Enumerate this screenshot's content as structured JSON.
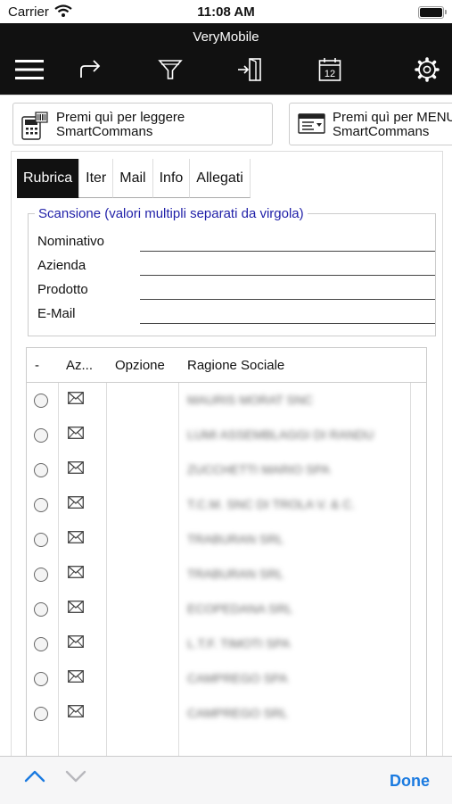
{
  "status_bar": {
    "carrier": "Carrier",
    "time": "11:08 AM"
  },
  "app": {
    "title": "VeryMobile"
  },
  "toolbar": {
    "icons": [
      "menu-icon",
      "share-arrow-icon",
      "filter-icon",
      "exit-door-icon",
      "calendar-icon",
      "gear-icon"
    ],
    "calendar_day": "12"
  },
  "scan_buttons": {
    "read": {
      "line1": "Premi quì per leggere",
      "line2": "SmartCommans"
    },
    "menu": {
      "line1": "Premi quì per MENU",
      "line2": "SmartCommans"
    }
  },
  "tabs": [
    {
      "label": "Rubrica",
      "active": true
    },
    {
      "label": "Iter",
      "active": false
    },
    {
      "label": "Mail",
      "active": false
    },
    {
      "label": "Info",
      "active": false
    },
    {
      "label": "Allegati",
      "active": false
    }
  ],
  "form": {
    "legend": "Scansione (valori multipli separati da virgola)",
    "fields": [
      {
        "label": "Nominativo",
        "value": ""
      },
      {
        "label": "Azienda",
        "value": ""
      },
      {
        "label": "Prodotto",
        "value": ""
      },
      {
        "label": "E-Mail",
        "value": ""
      }
    ]
  },
  "grid": {
    "columns": [
      "-",
      "Az...",
      "Opzione",
      "Ragione Sociale"
    ],
    "rows": [
      {
        "ragione_sociale": "MAURIS MORAT SNC"
      },
      {
        "ragione_sociale": "LUMI ASSEMBLAGGI DI RANDU"
      },
      {
        "ragione_sociale": "ZUCCHETTI MARIO SPA"
      },
      {
        "ragione_sociale": "T.C.M. SNC DI TROLA V. & C."
      },
      {
        "ragione_sociale": "TRABURAN SRL"
      },
      {
        "ragione_sociale": "TRABURAN SRL"
      },
      {
        "ragione_sociale": "ECOPEDANA SRL"
      },
      {
        "ragione_sociale": "L.T.F. TIMOTI SPA"
      },
      {
        "ragione_sociale": "CAMPREGO SPA"
      },
      {
        "ragione_sociale": "CAMPREGO SRL"
      }
    ]
  },
  "keyboard_bar": {
    "done_label": "Done"
  },
  "colors": {
    "header_bg": "#111111",
    "legend": "#1f1fa8",
    "done": "#1a7ae0"
  }
}
